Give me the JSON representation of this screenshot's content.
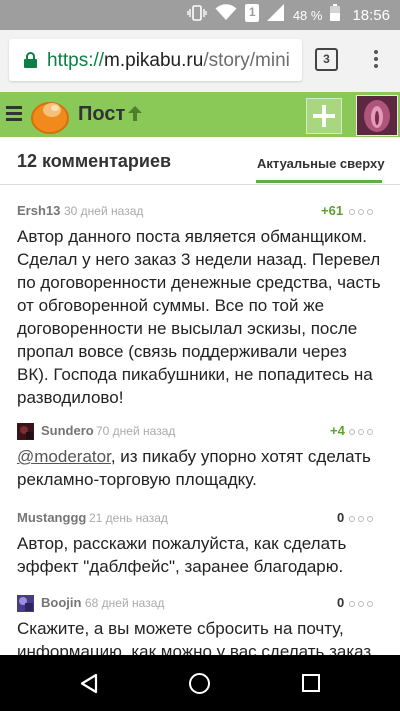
{
  "status_bar": {
    "battery_percent": "48 %",
    "time": "18:56",
    "notification_badge": "1",
    "bg_color": "#9e9e9e"
  },
  "browser": {
    "url_scheme": "https://",
    "url_host": "m.pikabu.ru",
    "url_path": "/story/mini",
    "tab_count": "3",
    "secure_color": "#0b8043"
  },
  "header": {
    "title": "Пост",
    "accent": "#8ac858"
  },
  "comments_header": {
    "count_label": "12 комментариев",
    "sort_label": "Актуальные сверху"
  },
  "comments": [
    {
      "author": "Ersh13",
      "time": "30 дней назад",
      "rating": "+61",
      "text": "Автор данного поста является обманщиком. Сделал у него заказ 3 недели назад. Перевел по договоренности денежные средства, часть от обговоренной суммы. Все по той же договоренности не высылал эскизы, после пропал вовсе (связь поддерживали через ВК). Господа пикабушники, не попадитесь на разводилово!"
    },
    {
      "author": "Sundero",
      "time": "70 дней назад",
      "rating": "+4",
      "mention": "@moderator",
      "text": ", из пикабу упорно хотят сделать рекламно-торговую площадку."
    },
    {
      "author": "Mustanggg",
      "time": "21 день назад",
      "rating": "0",
      "text": "Автор, расскажи пожалуйста, как сделать эффект \"даблфейс\", заранее благодарю."
    },
    {
      "author": "Boojin",
      "time": "68 дней назад",
      "rating": "0",
      "text": "Скажите, а вы можете сбросить на почту, информацию, как можно у вас сделать заказ и"
    }
  ]
}
